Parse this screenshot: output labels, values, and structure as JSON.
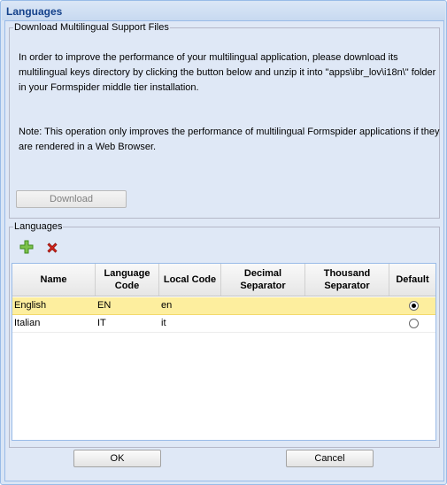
{
  "window": {
    "title": "Languages"
  },
  "download_section": {
    "legend": "Download Multilingual Support Files",
    "text_lines": [
      "In order to improve the performance of your multilingual application, please download its",
      "multilingual keys directory by clicking the button below and unzip it into \"apps\\ibr_lov\\i18n\\\" folder",
      "in your Formspider middle tier installation."
    ],
    "note_lines": [
      "Note: This operation only improves the performance of multilingual Formspider applications if they",
      "are rendered in a Web Browser."
    ],
    "download_label": "Download"
  },
  "languages_section": {
    "legend": "Languages",
    "toolbar": {
      "add_icon": "add-icon",
      "delete_icon": "delete-icon"
    },
    "columns": [
      {
        "label": "Name"
      },
      {
        "label": "Language Code"
      },
      {
        "label": "Local Code"
      },
      {
        "label": "Decimal Separator"
      },
      {
        "label": "Thousand Separator"
      },
      {
        "label": "Default"
      }
    ],
    "rows": [
      {
        "name": "English",
        "language_code": "EN",
        "local_code": "en",
        "decimal_separator": "",
        "thousand_separator": "",
        "default": true
      },
      {
        "name": "Italian",
        "language_code": "IT",
        "local_code": "it",
        "decimal_separator": "",
        "thousand_separator": "",
        "default": false
      }
    ]
  },
  "footer": {
    "ok_label": "OK",
    "cancel_label": "Cancel"
  },
  "colors": {
    "title": "#15428b",
    "selected_row": "#fdee9e",
    "frame_border": "#99bbe8",
    "panel_bg": "#dfe8f6"
  }
}
